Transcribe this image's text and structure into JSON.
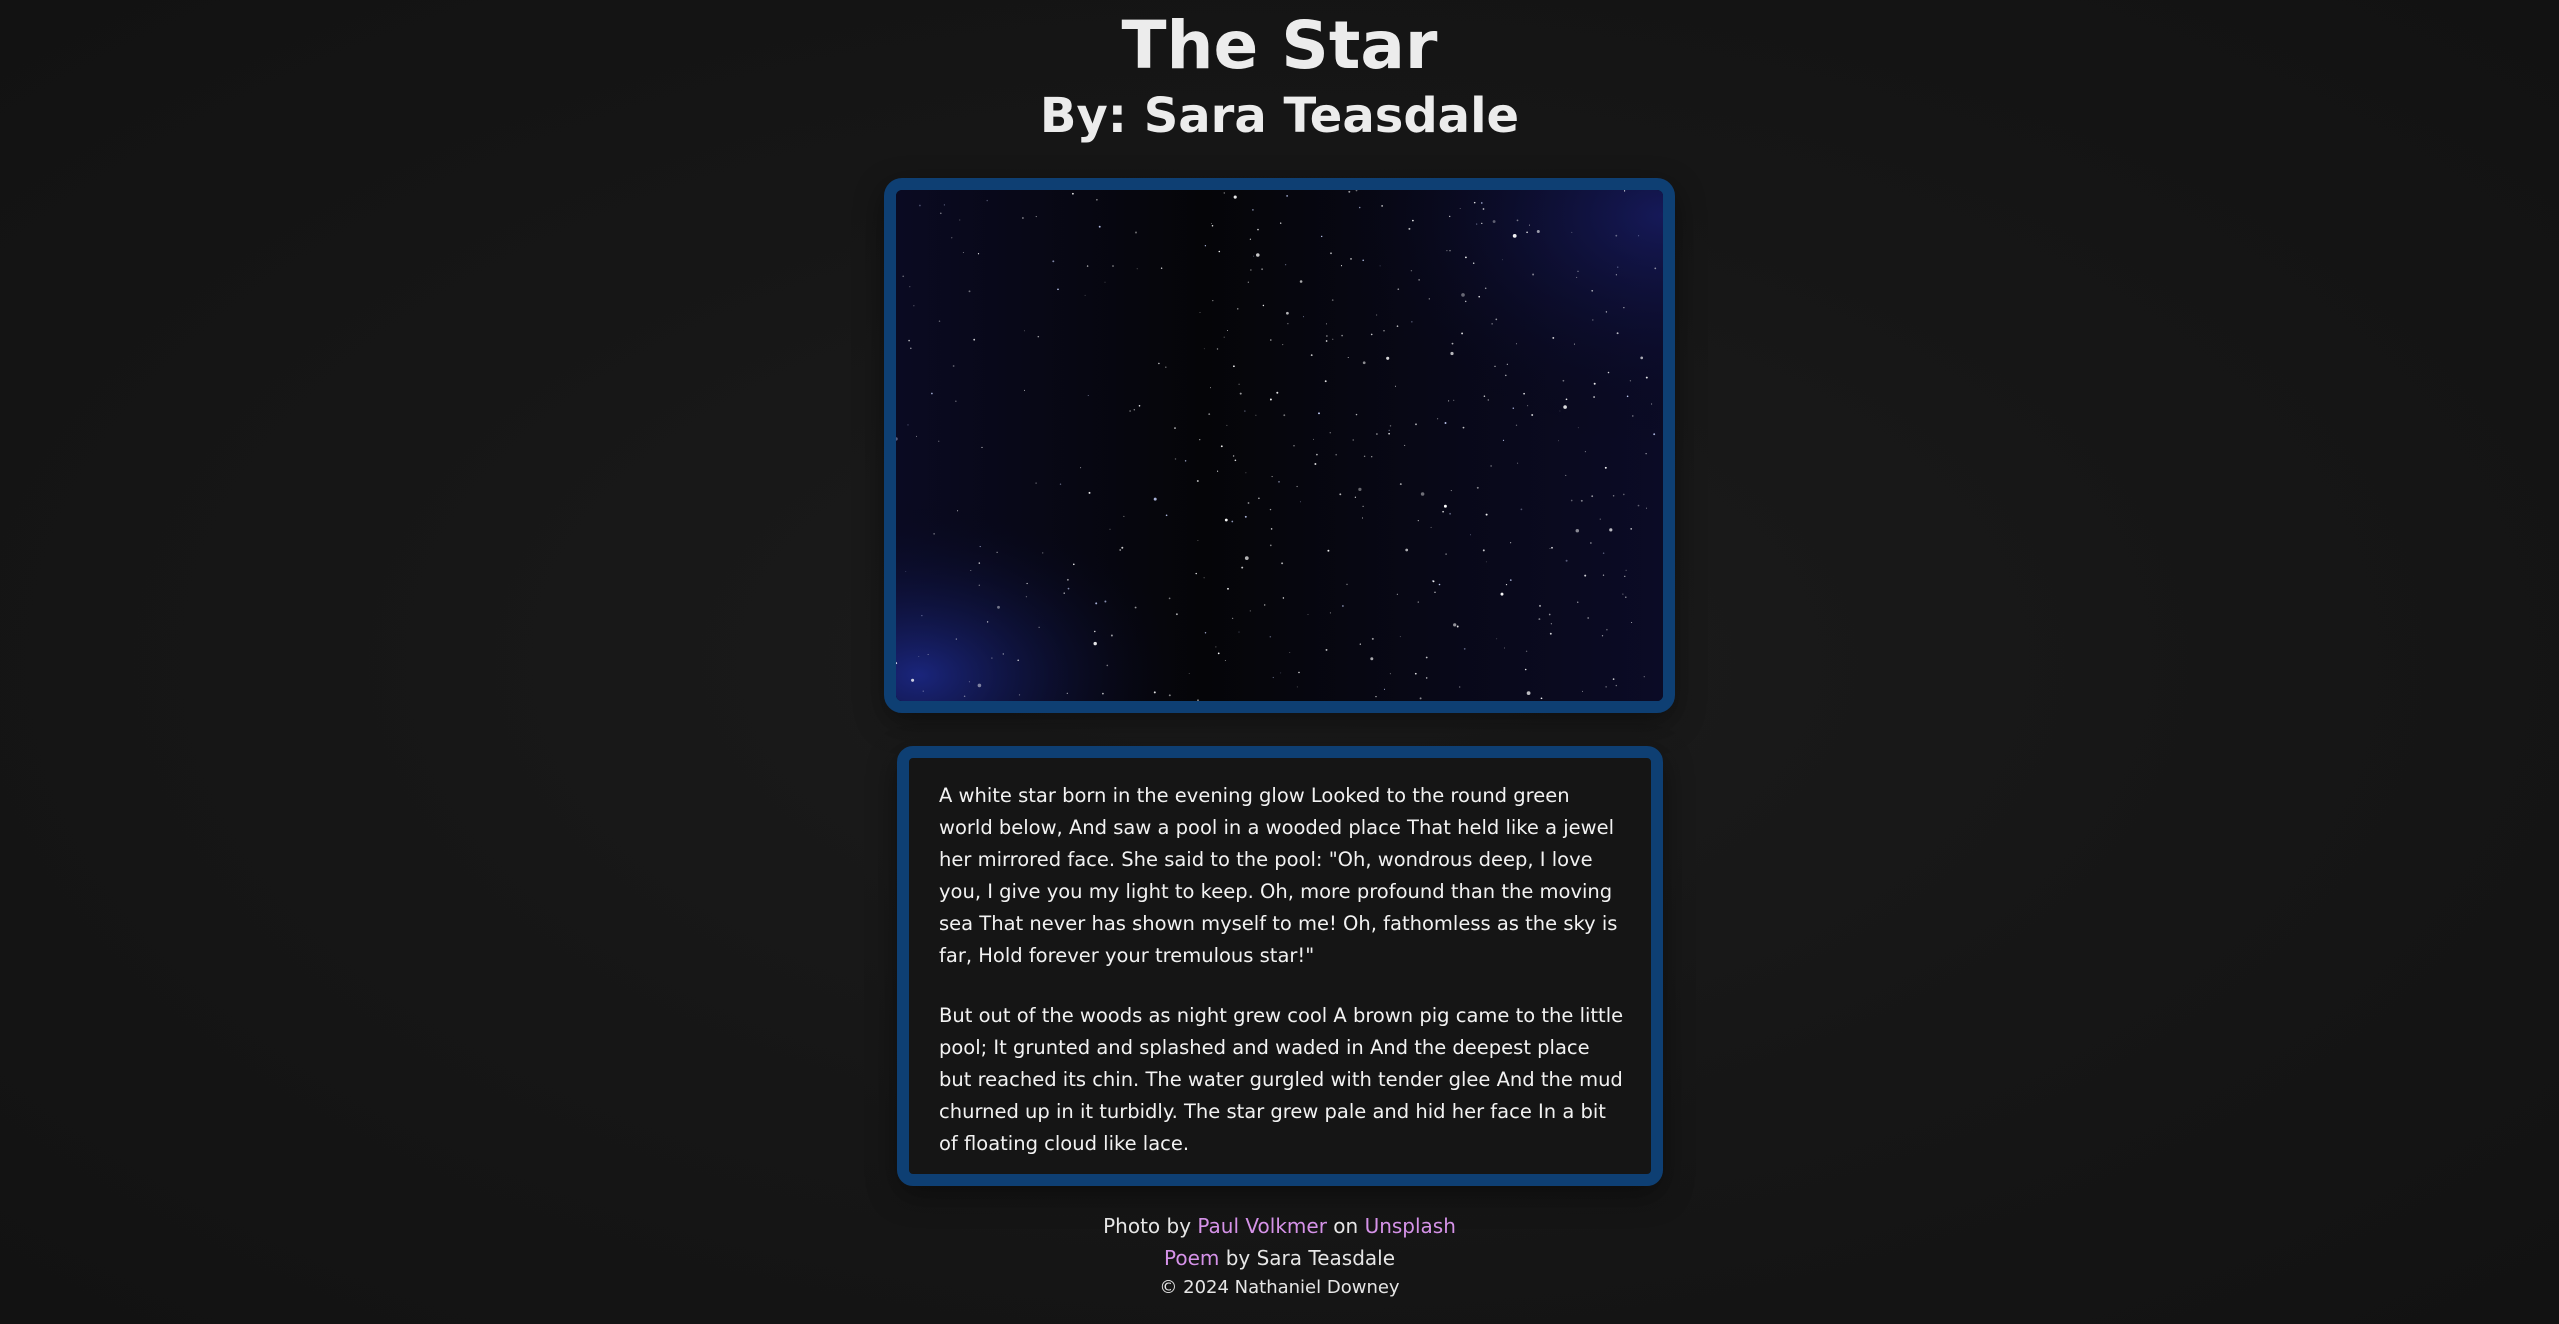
{
  "header": {
    "title": "The Star",
    "byline": "By: Sara Teasdale"
  },
  "poem": {
    "stanzas": [
      "A white star born in the evening glow Looked to the round green world below, And saw a pool in a wooded place That held like a jewel her mirrored face. She said to the pool: \"Oh, wondrous deep, I love you, I give you my light to keep. Oh, more profound than the moving sea That never has shown myself to me! Oh, fathomless as the sky is far, Hold forever your tremulous star!\"",
      "But out of the woods as night grew cool A brown pig came to the little pool; It grunted and splashed and waded in And the deepest place but reached its chin. The water gurgled with tender glee And the mud churned up in it turbidly. The star grew pale and hid her face In a bit of floating cloud like lace."
    ]
  },
  "footer": {
    "photo_prefix": "Photo by ",
    "photographer_link": "Paul Volkmer",
    "on_text": " on ",
    "site_link": "Unsplash",
    "poem_link": "Poem",
    "poem_suffix": " by Sara Teasdale",
    "copyright": "© 2024 Nathaniel Downey"
  },
  "colors": {
    "frame_border": "#0e3f73",
    "link": "#d592e8",
    "background": "#161616"
  }
}
